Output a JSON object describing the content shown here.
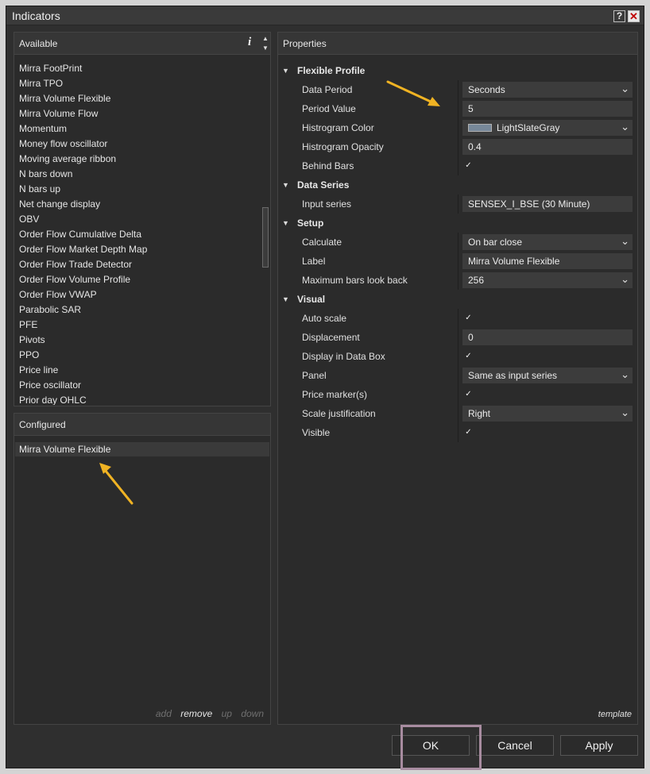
{
  "window": {
    "title": "Indicators",
    "help_glyph": "?",
    "close_glyph": "✕"
  },
  "available": {
    "header": "Available",
    "info_glyph": "i",
    "items": [
      "Mirra FootPrint",
      "Mirra TPO",
      "Mirra Volume Flexible",
      "Mirra Volume Flow",
      "Momentum",
      "Money flow oscillator",
      "Moving average ribbon",
      "N bars down",
      "N bars up",
      "Net change display",
      "OBV",
      "Order Flow Cumulative Delta",
      "Order Flow Market Depth Map",
      "Order Flow Trade Detector",
      "Order Flow Volume Profile",
      "Order Flow VWAP",
      "Parabolic SAR",
      "PFE",
      "Pivots",
      "PPO",
      "Price line",
      "Price oscillator",
      "Prior day OHLC"
    ]
  },
  "configured": {
    "header": "Configured",
    "items": [
      "Mirra Volume Flexible"
    ],
    "actions": {
      "add": "add",
      "remove": "remove",
      "up": "up",
      "down": "down"
    }
  },
  "properties": {
    "header": "Properties",
    "template_label": "template",
    "categories": [
      {
        "name": "Flexible Profile",
        "rows": [
          {
            "label": "Data Period",
            "type": "select",
            "value": "Seconds"
          },
          {
            "label": "Period Value",
            "type": "text",
            "value": "5"
          },
          {
            "label": "Histrogram Color",
            "type": "color",
            "value": "LightSlateGray",
            "color": "#778899"
          },
          {
            "label": "Histrogram Opacity",
            "type": "text",
            "value": "0.4"
          },
          {
            "label": "Behind Bars",
            "type": "checkbox",
            "checked": true
          }
        ]
      },
      {
        "name": "Data Series",
        "rows": [
          {
            "label": "Input series",
            "type": "text",
            "value": "SENSEX_I_BSE (30 Minute)"
          }
        ]
      },
      {
        "name": "Setup",
        "rows": [
          {
            "label": "Calculate",
            "type": "select",
            "value": "On bar close"
          },
          {
            "label": "Label",
            "type": "text",
            "value": "Mirra Volume Flexible"
          },
          {
            "label": "Maximum bars look back",
            "type": "select",
            "value": "256"
          }
        ]
      },
      {
        "name": "Visual",
        "rows": [
          {
            "label": "Auto scale",
            "type": "checkbox",
            "checked": true
          },
          {
            "label": "Displacement",
            "type": "text",
            "value": "0"
          },
          {
            "label": "Display in Data Box",
            "type": "checkbox",
            "checked": true
          },
          {
            "label": "Panel",
            "type": "select",
            "value": "Same as input series"
          },
          {
            "label": "Price marker(s)",
            "type": "checkbox",
            "checked": true
          },
          {
            "label": "Scale justification",
            "type": "select",
            "value": "Right"
          },
          {
            "label": "Visible",
            "type": "checkbox",
            "checked": true
          }
        ]
      }
    ]
  },
  "buttons": {
    "ok": "OK",
    "cancel": "Cancel",
    "apply": "Apply"
  },
  "colors": {
    "window_bg": "#2f2f2f",
    "annotation_arrow": "#f0b323",
    "ok_highlight": "#a88ca0"
  }
}
